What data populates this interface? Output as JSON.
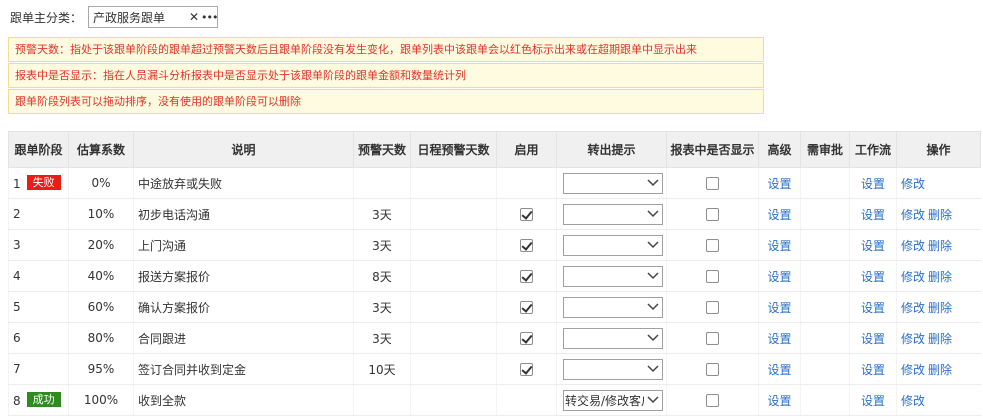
{
  "filter": {
    "label": "跟单主分类：",
    "value": "产政服务跟单",
    "clear_icon": "close-icon",
    "more_icon": "ellipsis-icon"
  },
  "tips": [
    "预警天数：指处于该跟单阶段的跟单超过预警天数后且跟单阶段没有发生变化，跟单列表中该跟单会以红色标示出来或在超期跟单中显示出来",
    "报表中是否显示：指在人员漏斗分析报表中是否显示处于该跟单阶段的跟单金额和数量统计列",
    "跟单阶段列表可以拖动排序，没有使用的跟单阶段可以删除"
  ],
  "table": {
    "headers": [
      "跟单阶段",
      "估算系数",
      "说明",
      "预警天数",
      "日程预警天数",
      "启用",
      "转出提示",
      "报表中是否显示",
      "高级",
      "需审批",
      "工作流",
      "操作"
    ],
    "set_label": "设置",
    "edit_label": "修改",
    "delete_label": "删除",
    "rows": [
      {
        "num": "1",
        "badge": "失败",
        "badge_type": "fail",
        "coef": "0%",
        "desc": "中途放弃或失败",
        "warn": "",
        "sched": "",
        "enabled": null,
        "transfer": "",
        "report": false,
        "deletable": false
      },
      {
        "num": "2",
        "badge": "",
        "badge_type": "",
        "coef": "10%",
        "desc": "初步电话沟通",
        "warn": "3天",
        "sched": "",
        "enabled": true,
        "transfer": "",
        "report": false,
        "deletable": true
      },
      {
        "num": "3",
        "badge": "",
        "badge_type": "",
        "coef": "20%",
        "desc": "上门沟通",
        "warn": "3天",
        "sched": "",
        "enabled": true,
        "transfer": "",
        "report": false,
        "deletable": true
      },
      {
        "num": "4",
        "badge": "",
        "badge_type": "",
        "coef": "40%",
        "desc": "报送方案报价",
        "warn": "8天",
        "sched": "",
        "enabled": true,
        "transfer": "",
        "report": false,
        "deletable": true
      },
      {
        "num": "5",
        "badge": "",
        "badge_type": "",
        "coef": "60%",
        "desc": "确认方案报价",
        "warn": "3天",
        "sched": "",
        "enabled": true,
        "transfer": "",
        "report": false,
        "deletable": true
      },
      {
        "num": "6",
        "badge": "",
        "badge_type": "",
        "coef": "80%",
        "desc": "合同跟进",
        "warn": "3天",
        "sched": "",
        "enabled": true,
        "transfer": "",
        "report": false,
        "deletable": true
      },
      {
        "num": "7",
        "badge": "",
        "badge_type": "",
        "coef": "95%",
        "desc": "签订合同并收到定金",
        "warn": "10天",
        "sched": "",
        "enabled": true,
        "transfer": "",
        "report": false,
        "deletable": true
      },
      {
        "num": "8",
        "badge": "成功",
        "badge_type": "succ",
        "coef": "100%",
        "desc": "收到全款",
        "warn": "",
        "sched": "",
        "enabled": null,
        "transfer": "转交易/修改客户",
        "report": false,
        "deletable": false
      }
    ]
  }
}
